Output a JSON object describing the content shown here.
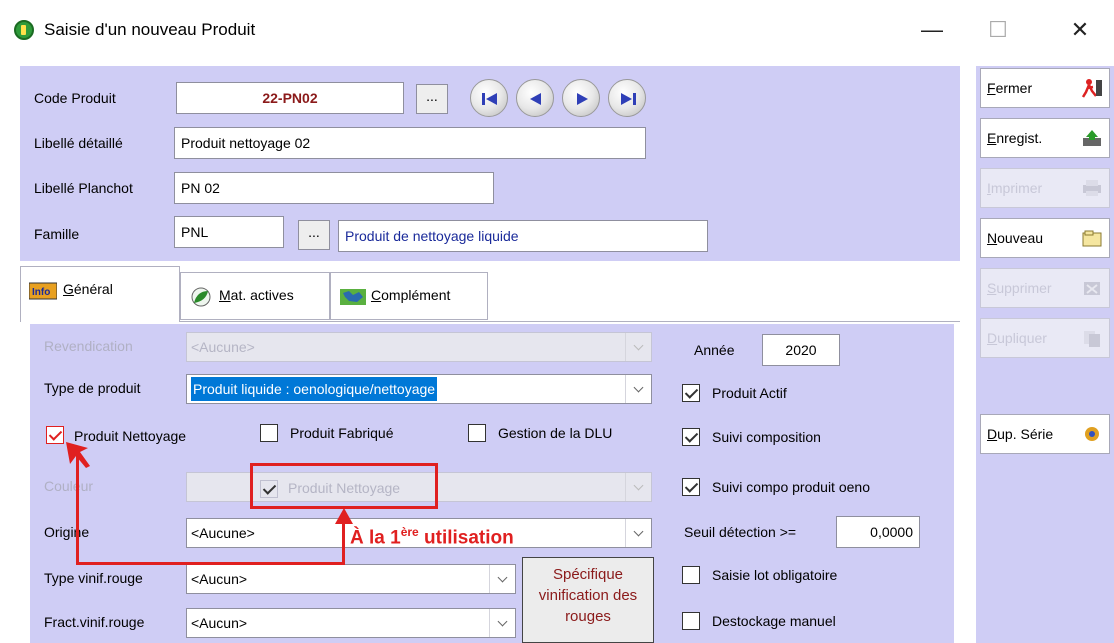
{
  "window": {
    "title": "Saisie d'un nouveau Produit",
    "minimize": "—",
    "maximize": "☐",
    "close": "✕"
  },
  "header": {
    "code_label": "Code Produit",
    "code_value": "22-PN02",
    "libelle_detail_label": "Libellé détaillé",
    "libelle_detail_value": "Produit nettoyage 02",
    "libelle_planchot_label": "Libellé Planchot",
    "libelle_planchot_value": "PN 02",
    "famille_label": "Famille",
    "famille_code": "PNL",
    "famille_libelle": "Produit de nettoyage liquide",
    "ellipsis": "..."
  },
  "right_buttons": [
    {
      "label": "Fermer",
      "enabled": true,
      "icon": "exit-icon"
    },
    {
      "label": "Enregist.",
      "enabled": true,
      "icon": "save-icon"
    },
    {
      "label": "Imprimer",
      "enabled": false,
      "icon": "printer-icon"
    },
    {
      "label": "Nouveau",
      "enabled": true,
      "icon": "new-icon"
    },
    {
      "label": "Supprimer",
      "enabled": false,
      "icon": "delete-icon"
    },
    {
      "label": "Dupliquer",
      "enabled": false,
      "icon": "duplicate-icon"
    },
    {
      "label": "Dup. Série",
      "enabled": true,
      "icon": "series-icon"
    }
  ],
  "tabs": [
    {
      "label": "Général",
      "icon": "info-icon",
      "active": true
    },
    {
      "label": "Mat. actives",
      "icon": "leaf-icon",
      "active": false
    },
    {
      "label": "Complément",
      "icon": "map-icon",
      "active": false
    }
  ],
  "general": {
    "revendication_label": "Revendication",
    "revendication_value": "<Aucune>",
    "type_produit_label": "Type de produit",
    "type_produit_value": "Produit liquide : oenologique/nettoyage",
    "produit_nettoyage_label": "Produit Nettoyage",
    "produit_fabrique_label": "Produit Fabriqué",
    "gestion_dlu_label": "Gestion de la DLU",
    "couleur_label": "Couleur",
    "couleur_overlay": "Produit Nettoyage",
    "origine_label": "Origine",
    "origine_value": "<Aucune>",
    "type_vinif_label": "Type vinif.rouge",
    "type_vinif_value": "<Aucun>",
    "fract_vinif_label": "Fract.vinif.rouge",
    "fract_vinif_value": "<Aucun>",
    "specifique_button": "Spécifique vinification des rouges",
    "annee_label": "Année",
    "annee_value": "2020",
    "produit_actif_label": "Produit Actif",
    "suivi_composition_label": "Suivi composition",
    "suivi_compo_oeno_label": "Suivi compo produit oeno",
    "seuil_label": "Seuil détection >=",
    "seuil_value": "0,0000",
    "saisie_lot_label": "Saisie lot obligatoire",
    "destockage_label": "Destockage manuel"
  },
  "annotation": {
    "text_prefix": "À la 1",
    "text_sup": "ère",
    "text_suffix": " utilisation",
    "color": "#e02020"
  },
  "colors": {
    "panel": "#cfcdf5",
    "code_text": "#8b1a1a",
    "selection": "#0078d7"
  }
}
